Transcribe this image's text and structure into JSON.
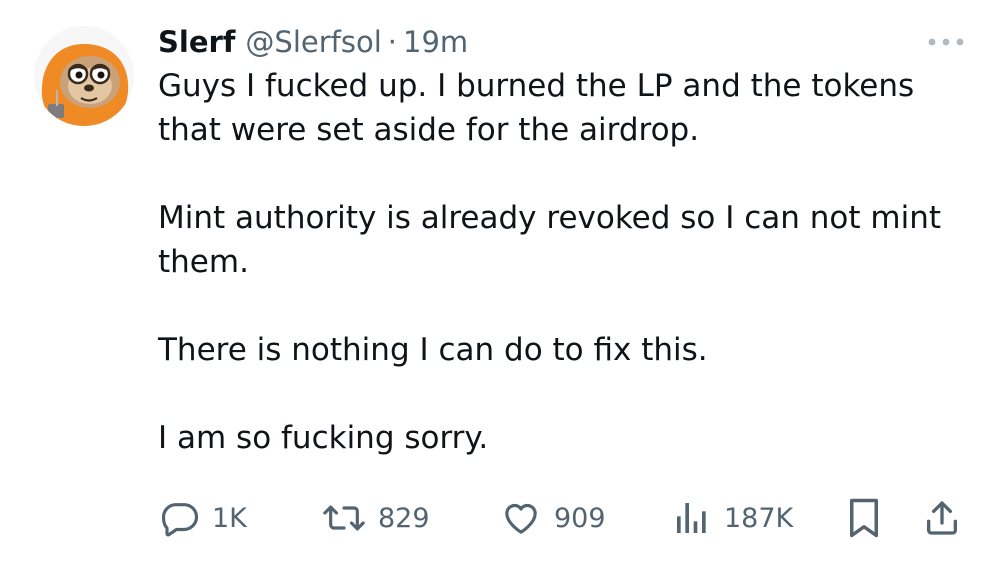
{
  "tweet": {
    "author": {
      "name": "Slerf",
      "handle": "@Slerfsol",
      "separator": "·",
      "time": "19m",
      "avatar_icon": "sloth-avatar-icon"
    },
    "paragraphs": [
      [
        "Guys I fucked up. I burned the LP and the tokens",
        "that were set aside for the airdrop."
      ],
      [
        "Mint authority is already revoked so I can not mint",
        "them."
      ],
      [
        "There is nothing I can do to fix this."
      ],
      [
        "I am so fucking sorry."
      ]
    ],
    "actions": {
      "reply": {
        "icon": "reply-icon",
        "count": "1K"
      },
      "repost": {
        "icon": "repost-icon",
        "count": "829"
      },
      "like": {
        "icon": "heart-icon",
        "count": "909"
      },
      "views": {
        "icon": "views-chart-icon",
        "count": "187K"
      },
      "bookmark": {
        "icon": "bookmark-icon"
      },
      "share": {
        "icon": "share-icon"
      }
    },
    "more_icon": "more-options-icon"
  },
  "colors": {
    "text": "#0f1419",
    "secondary": "#536471",
    "icon": "#536471",
    "avatar_orange": "#f08a24"
  }
}
